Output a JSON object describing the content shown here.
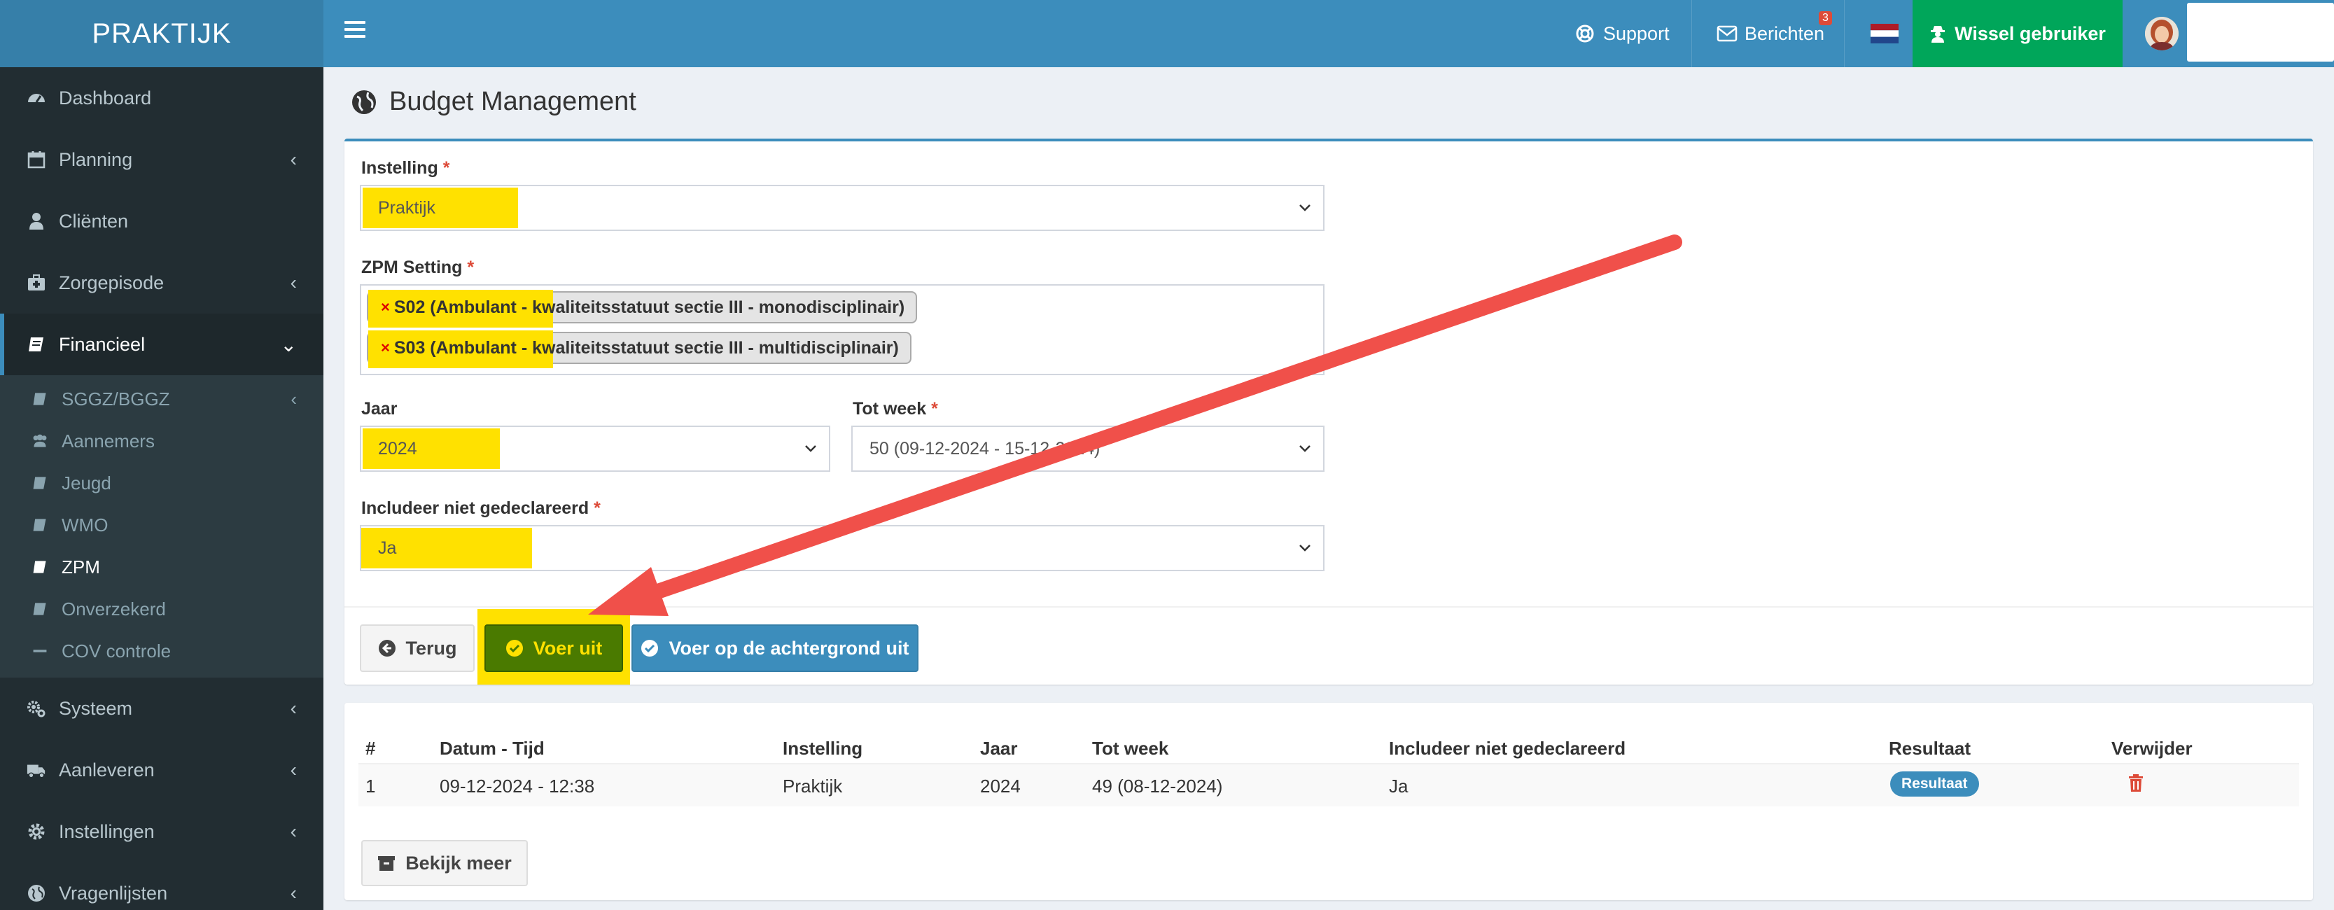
{
  "app": {
    "logo": "PRAKTIJK"
  },
  "sidebar": {
    "items": [
      {
        "label": "Dashboard",
        "icon": "dashboard-icon"
      },
      {
        "label": "Planning",
        "icon": "calendar-icon"
      },
      {
        "label": "Cliënten",
        "icon": "user-icon"
      },
      {
        "label": "Zorgepisode",
        "icon": "medkit-icon"
      },
      {
        "label": "Financieel",
        "icon": "book-icon"
      },
      {
        "label": "Systeem",
        "icon": "gears-icon"
      },
      {
        "label": "Aanleveren",
        "icon": "truck-icon"
      },
      {
        "label": "Instellingen",
        "icon": "gear-icon"
      },
      {
        "label": "Vragenlijsten",
        "icon": "globe-icon"
      }
    ],
    "financieel_sub": [
      {
        "label": "SGGZ/BGGZ"
      },
      {
        "label": "Aannemers"
      },
      {
        "label": "Jeugd"
      },
      {
        "label": "WMO"
      },
      {
        "label": "ZPM"
      },
      {
        "label": "Onverzekerd"
      },
      {
        "label": "COV controle"
      }
    ]
  },
  "header": {
    "support": "Support",
    "messages": "Berichten",
    "messages_count": "3",
    "switch_user": "Wissel gebruiker"
  },
  "page": {
    "title": "Budget Management"
  },
  "form": {
    "instelling": {
      "label": "Instelling",
      "value": "Praktijk"
    },
    "zpm_setting": {
      "label": "ZPM Setting",
      "tags": [
        "S02 (Ambulant - kwaliteitsstatuut sectie III - monodisciplinair)",
        "S03 (Ambulant - kwaliteitsstatuut sectie III - multidisciplinair)"
      ]
    },
    "jaar": {
      "label": "Jaar",
      "value": "2024"
    },
    "tot_week": {
      "label": "Tot week",
      "value": "50 (09-12-2024 - 15-12-2024)"
    },
    "includeer": {
      "label": "Includeer niet gedeclareerd",
      "value": "Ja"
    },
    "required_mark": "*"
  },
  "buttons": {
    "back": "Terug",
    "run": "Voer uit",
    "run_background": "Voer op de achtergrond uit",
    "more": "Bekijk meer"
  },
  "table": {
    "headers": [
      "#",
      "Datum - Tijd",
      "Instelling",
      "Jaar",
      "Tot week",
      "Includeer niet gedeclareerd",
      "Resultaat",
      "Verwijder"
    ],
    "rows": [
      {
        "nr": "1",
        "datum": "09-12-2024 - 12:38",
        "instelling": "Praktijk",
        "jaar": "2024",
        "tot_week": "49 (08-12-2024)",
        "includeer": "Ja",
        "resultaat": "Resultaat"
      }
    ]
  },
  "colors": {
    "header": "#3c8dbc",
    "sidebar": "#222d32",
    "highlight": "#ffe100",
    "run_button": "#4a7a00",
    "switch_user": "#00a65a",
    "arrow": "#f0504a"
  }
}
